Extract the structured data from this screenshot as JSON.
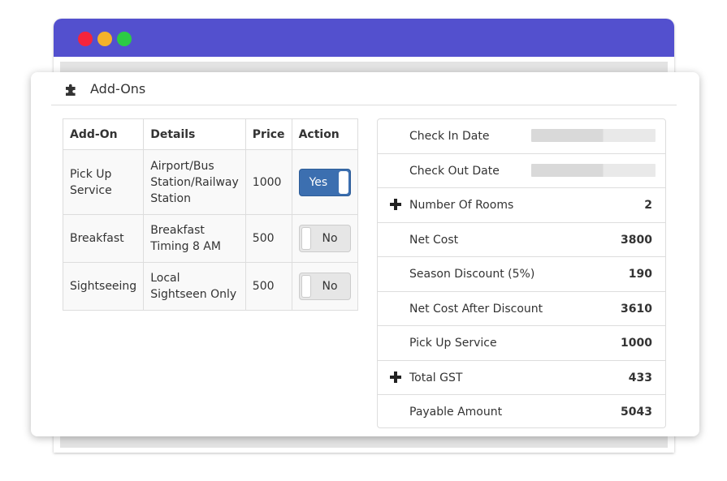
{
  "panel": {
    "title": "Add-Ons",
    "icon": "puzzle-icon"
  },
  "browser": {
    "bar_color": "#5350ce",
    "dots": [
      "#f5243c",
      "#f3b229",
      "#2ccb44"
    ]
  },
  "addons_table": {
    "headers": [
      "Add-On",
      "Details",
      "Price",
      "Action"
    ],
    "rows": [
      {
        "addon": "Pick Up Service",
        "details": "Airport/Bus Station/Railway Station",
        "price": "1000",
        "action": "Yes",
        "enabled": true
      },
      {
        "addon": "Breakfast",
        "details": "Breakfast Timing 8 AM",
        "price": "500",
        "action": "No",
        "enabled": false
      },
      {
        "addon": "Sightseeing",
        "details": "Local Sightseen Only",
        "price": "500",
        "action": "No",
        "enabled": false
      }
    ]
  },
  "summary": {
    "rows": [
      {
        "label": "Check In Date",
        "value": "",
        "expandable": false
      },
      {
        "label": "Check Out Date",
        "value": "",
        "expandable": false
      },
      {
        "label": "Number Of Rooms",
        "value": "2",
        "expandable": true
      },
      {
        "label": "Net Cost",
        "value": "3800",
        "expandable": false
      },
      {
        "label": "Season Discount (5%)",
        "value": "190",
        "expandable": false
      },
      {
        "label": "Net Cost After Discount",
        "value": "3610",
        "expandable": false
      },
      {
        "label": "Pick Up Service",
        "value": "1000",
        "expandable": false
      },
      {
        "label": "Total GST",
        "value": "433",
        "expandable": true
      },
      {
        "label": "Payable Amount",
        "value": "5043",
        "expandable": false
      }
    ]
  },
  "colors": {
    "accent": "#5350ce",
    "toggle_on": "#3c6fb0"
  }
}
